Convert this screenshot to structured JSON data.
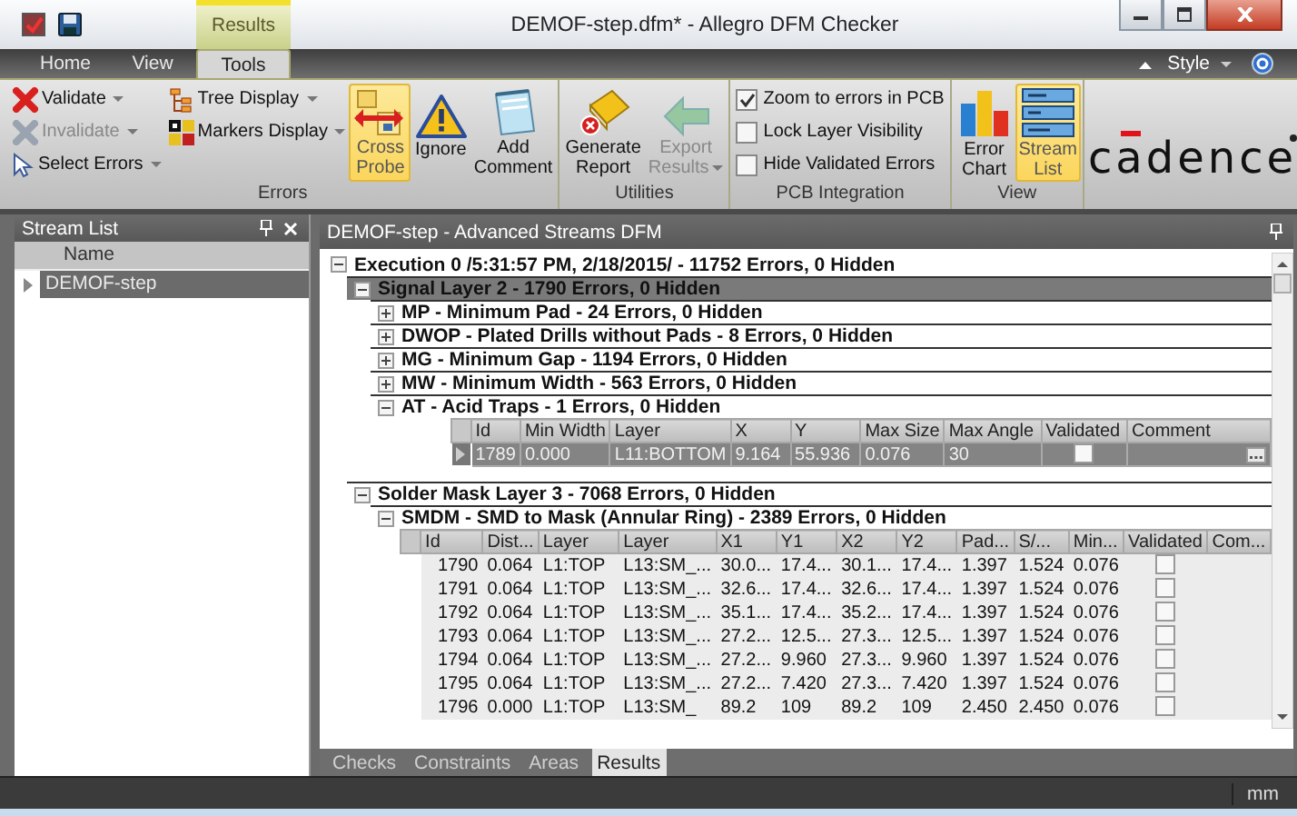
{
  "window": {
    "title": "DEMOF-step.dfm* - Allegro DFM Checker",
    "context_tab": "Results"
  },
  "ribbon_tabs": [
    {
      "label": "Home",
      "selected": false
    },
    {
      "label": "View",
      "selected": false
    },
    {
      "label": "Tools",
      "selected": true
    }
  ],
  "style_menu": {
    "label": "Style"
  },
  "ribbon_groups": [
    {
      "label": "Errors",
      "stacks": [
        [
          {
            "kind": "small",
            "label": "Validate",
            "dropdown": true,
            "disabled": false
          },
          {
            "kind": "small",
            "label": "Invalidate",
            "dropdown": true,
            "disabled": true
          },
          {
            "kind": "small",
            "label": "Select Errors",
            "dropdown": true,
            "disabled": false
          }
        ],
        [
          {
            "kind": "small",
            "label": "Tree Display",
            "dropdown": true,
            "disabled": false
          },
          {
            "kind": "small",
            "label": "Markers Display",
            "dropdown": true,
            "disabled": false
          }
        ],
        [
          {
            "kind": "large",
            "label": "Cross\nProbe",
            "selected": true,
            "disabled": false
          }
        ],
        [
          {
            "kind": "large",
            "label": "Ignore",
            "selected": false,
            "disabled": false
          }
        ],
        [
          {
            "kind": "large",
            "label": "Add\nComment",
            "selected": false,
            "disabled": false
          }
        ]
      ]
    },
    {
      "label": "Utilities",
      "stacks": [
        [
          {
            "kind": "large",
            "label": "Generate\nReport",
            "selected": false,
            "disabled": false
          }
        ],
        [
          {
            "kind": "large",
            "label": "Export\nResults",
            "selected": false,
            "disabled": true,
            "dropdown": true
          }
        ]
      ]
    },
    {
      "label": "PCB Integration",
      "stacks": [
        [
          {
            "kind": "check",
            "label": "Zoom to errors in PCB",
            "checked": true
          },
          {
            "kind": "check",
            "label": "Lock Layer Visibility",
            "checked": false
          },
          {
            "kind": "check",
            "label": "Hide Validated Errors",
            "checked": false
          }
        ]
      ]
    },
    {
      "label": "View",
      "stacks": [
        [
          {
            "kind": "large",
            "label": "Error\nChart",
            "selected": false,
            "disabled": false
          }
        ],
        [
          {
            "kind": "large",
            "label": "Stream\nList",
            "selected": true,
            "disabled": false
          }
        ]
      ]
    }
  ],
  "logo": {
    "text": "cadence"
  },
  "stream_list": {
    "title": "Stream List",
    "column": "Name",
    "items": [
      {
        "label": "DEMOF-step",
        "selected": true
      }
    ]
  },
  "results_panel": {
    "title": "DEMOF-step - Advanced Streams DFM",
    "tree": [
      {
        "label": "Execution 0 /5:31:57 PM, 2/18/2015/ - 11752 Errors, 0 Hidden",
        "expanded": true,
        "selected": false,
        "children": [
          {
            "label": "Signal Layer 2 - 1790 Errors, 0 Hidden",
            "expanded": true,
            "selected": true,
            "children": [
              {
                "label": "MP - Minimum Pad - 24 Errors, 0 Hidden",
                "expanded": false,
                "selected": false
              },
              {
                "label": "DWOP - Plated Drills without Pads - 8 Errors, 0 Hidden",
                "expanded": false,
                "selected": false
              },
              {
                "label": "MG - Minimum Gap - 1194 Errors, 0 Hidden",
                "expanded": false,
                "selected": false
              },
              {
                "label": "MW - Minimum Width - 563 Errors, 0 Hidden",
                "expanded": false,
                "selected": false
              },
              {
                "label": "AT - Acid Traps - 1 Errors, 0 Hidden",
                "expanded": true,
                "selected": false,
                "grid": {
                  "columns": [
                    "Id",
                    "Min Width",
                    "Layer",
                    "X",
                    "Y",
                    "Max Size",
                    "Max Angle",
                    "Validated",
                    "Comment"
                  ],
                  "rows": [
                    {
                      "cells": [
                        "1789",
                        "0.000",
                        "L11:BOTTOM",
                        "9.164",
                        "55.936",
                        "0.076",
                        "30"
                      ],
                      "validated": false,
                      "selected": true
                    }
                  ]
                }
              }
            ]
          },
          {
            "label": "Solder Mask Layer 3 - 7068 Errors, 0 Hidden",
            "expanded": true,
            "selected": false,
            "children": [
              {
                "label": "SMDM - SMD to Mask (Annular Ring) - 2389 Errors, 0 Hidden",
                "expanded": true,
                "selected": false,
                "grid": {
                  "columns": [
                    "Id",
                    "Dist...",
                    "Layer",
                    "Layer",
                    "X1",
                    "Y1",
                    "X2",
                    "Y2",
                    "Pad...",
                    "S/...",
                    "Min...",
                    "Validated",
                    "Com..."
                  ],
                  "rows": [
                    {
                      "cells": [
                        "1790",
                        "0.064",
                        "L1:TOP",
                        "L13:SM_...",
                        "30.0...",
                        "17.4...",
                        "30.1...",
                        "17.4...",
                        "1.397",
                        "1.524",
                        "0.076"
                      ],
                      "validated": false,
                      "selected": false
                    },
                    {
                      "cells": [
                        "1791",
                        "0.064",
                        "L1:TOP",
                        "L13:SM_...",
                        "32.6...",
                        "17.4...",
                        "32.6...",
                        "17.4...",
                        "1.397",
                        "1.524",
                        "0.076"
                      ],
                      "validated": false,
                      "selected": false
                    },
                    {
                      "cells": [
                        "1792",
                        "0.064",
                        "L1:TOP",
                        "L13:SM_...",
                        "35.1...",
                        "17.4...",
                        "35.2...",
                        "17.4...",
                        "1.397",
                        "1.524",
                        "0.076"
                      ],
                      "validated": false,
                      "selected": false
                    },
                    {
                      "cells": [
                        "1793",
                        "0.064",
                        "L1:TOP",
                        "L13:SM_...",
                        "27.2...",
                        "12.5...",
                        "27.3...",
                        "12.5...",
                        "1.397",
                        "1.524",
                        "0.076"
                      ],
                      "validated": false,
                      "selected": false
                    },
                    {
                      "cells": [
                        "1794",
                        "0.064",
                        "L1:TOP",
                        "L13:SM_...",
                        "27.2...",
                        "9.960",
                        "27.3...",
                        "9.960",
                        "1.397",
                        "1.524",
                        "0.076"
                      ],
                      "validated": false,
                      "selected": false
                    },
                    {
                      "cells": [
                        "1795",
                        "0.064",
                        "L1:TOP",
                        "L13:SM_...",
                        "27.2...",
                        "7.420",
                        "27.3...",
                        "7.420",
                        "1.397",
                        "1.524",
                        "0.076"
                      ],
                      "validated": false,
                      "selected": false
                    },
                    {
                      "cells": [
                        "1796",
                        "0.000",
                        "L1:TOP",
                        "L13:SM_",
                        "89.2",
                        "109",
                        "89.2",
                        "109",
                        "2.450",
                        "2.450",
                        "0.076"
                      ],
                      "validated": false,
                      "selected": false
                    }
                  ]
                }
              }
            ]
          }
        ]
      }
    ]
  },
  "bottom_tabs": [
    {
      "label": "Checks",
      "selected": false
    },
    {
      "label": "Constraints",
      "selected": false
    },
    {
      "label": "Areas",
      "selected": false
    },
    {
      "label": "Results",
      "selected": true
    }
  ],
  "status_bar": {
    "units": "mm"
  }
}
